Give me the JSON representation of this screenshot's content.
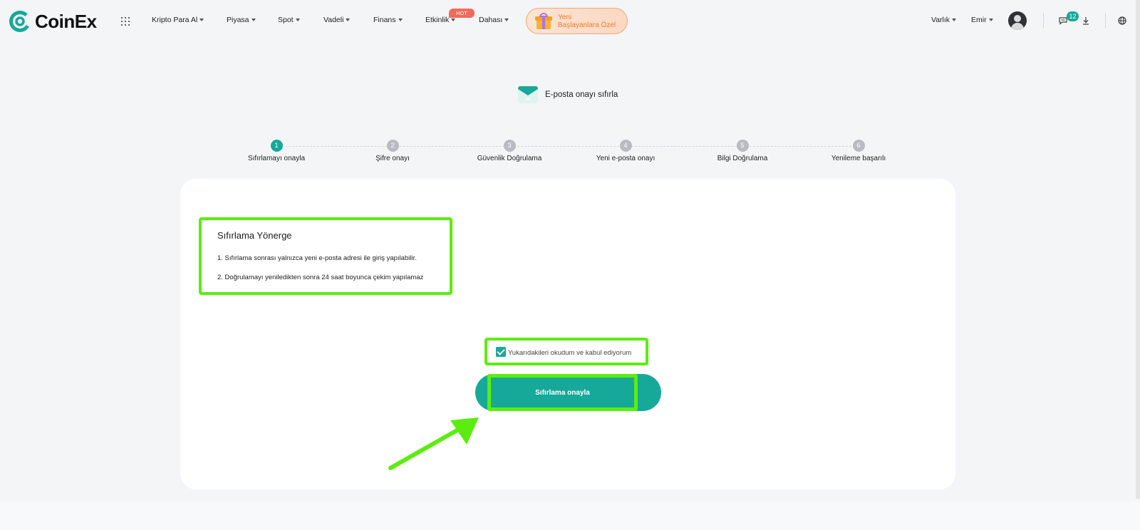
{
  "brand": {
    "name": "CoinEx",
    "accent": "#16a99a",
    "highlight": "#5ced0e"
  },
  "nav": {
    "items": [
      "Kripto Para Al",
      "Piyasa",
      "Spot",
      "Vadeli",
      "Finans",
      "Etkinlik",
      "Dahası"
    ],
    "hot_badge": "HOT",
    "promo_line1": "Yeni",
    "promo_line2": "Başlayanlara Özel",
    "asset_label": "Varlık",
    "order_label": "Emir",
    "notification_count": "12"
  },
  "header": {
    "title": "E-posta onayı sıfırla"
  },
  "steps": [
    {
      "num": "1",
      "label": "Sıfırlamayı onayla"
    },
    {
      "num": "2",
      "label": "Şifre onayı"
    },
    {
      "num": "3",
      "label": "Güvenlik Doğrulama"
    },
    {
      "num": "4",
      "label": "Yeni e-posta onayı"
    },
    {
      "num": "5",
      "label": "Bilgi Doğrulama"
    },
    {
      "num": "6",
      "label": "Yenileme başarılı"
    }
  ],
  "active_step": 1,
  "guide": {
    "title": "Sıfırlama Yönerge",
    "items": [
      "1. Sıfırlama sonrası yalnızca yeni e-posta adresi ile giriş yapılabilir.",
      "2. Doğrulamayı yeniledikten sonra 24 saat boyunca çekim yapılamaz"
    ]
  },
  "agreement": {
    "label": "Yukarıdakileri okudum ve kabul ediyorum",
    "checked": true
  },
  "confirm_button": {
    "label": "Sıfırlama onayla"
  },
  "icons": [
    "coinex-logo-icon",
    "apps-grid-icon",
    "gift-icon",
    "avatar-icon",
    "chat-icon",
    "download-icon",
    "globe-icon",
    "mail-icon",
    "check-icon",
    "arrow-icon"
  ]
}
